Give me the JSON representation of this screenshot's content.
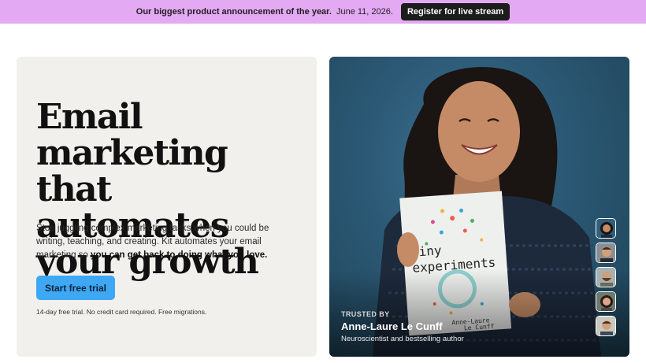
{
  "banner": {
    "announcement": "Our biggest product announcement of the year.",
    "date": "June 11, 2026.",
    "button_label": "Register for live stream"
  },
  "hero": {
    "headline": "Email marketing that automates your growth",
    "subtext_regular": "Stop juggling complex marketing tasks when you could be writing, teaching, and creating. Kit automates your email marketing so",
    "subtext_bold": "you can get back to doing what you love.",
    "cta_label": "Start free trial",
    "fine_print": "14-day free trial. No credit card required. Free migrations."
  },
  "testimonial": {
    "kicker": "TRUSTED BY",
    "name": "Anne-Laure Le Cunff",
    "role": "Neuroscientist and bestselling author",
    "book_title": "tiny experiments",
    "book_author": "Anne-Laure Le Cunff"
  },
  "colors": {
    "banner_bg": "#e3a9f2",
    "cta_bg": "#3ea8f5",
    "photo_bg": "#2b5874",
    "left_card_bg": "#f2f0ec"
  }
}
